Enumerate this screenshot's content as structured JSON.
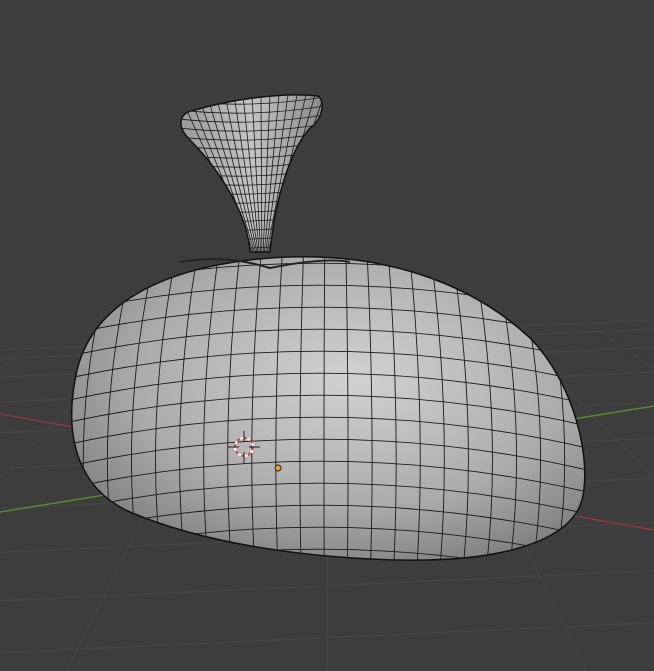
{
  "viewport": {
    "background_color": "#3d3d3d",
    "grid_color": "#474747",
    "x_axis_color": "#8a3a45",
    "y_axis_color": "#5a8a2e",
    "mesh_fill_light": "#c9c9c9",
    "mesh_fill_dark": "#7a7a7a",
    "wire_color": "#1a1a1a",
    "origin_color": "#f29a2a",
    "cursor_color": "#e23a3a"
  },
  "icons": [
    "3d-cursor-icon",
    "object-origin-icon"
  ]
}
